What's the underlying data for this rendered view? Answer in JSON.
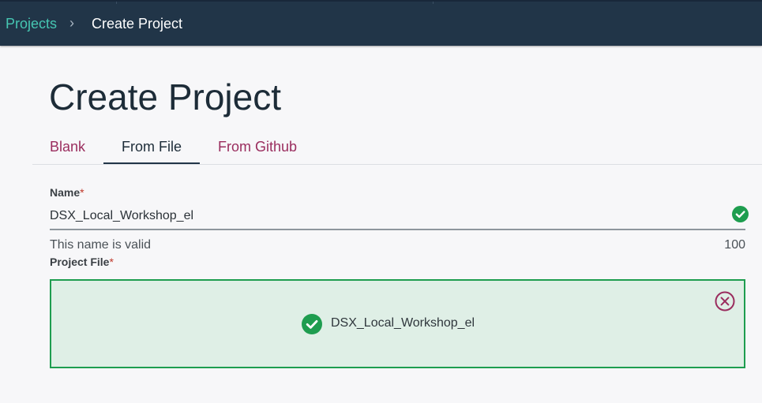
{
  "breadcrumb": {
    "parent": "Projects",
    "separator": "›",
    "current": "Create Project"
  },
  "page": {
    "title": "Create Project"
  },
  "tabs": [
    {
      "label": "Blank",
      "active": false
    },
    {
      "label": "From File",
      "active": true
    },
    {
      "label": "From Github",
      "active": false
    }
  ],
  "form": {
    "name": {
      "label": "Name",
      "required_mark": "*",
      "value": "DSX_Local_Workshop_el",
      "validation": "This name is valid",
      "max_length": "100"
    },
    "project_file": {
      "label": "Project File",
      "required_mark": "*",
      "file_name": "DSX_Local_Workshop_el"
    }
  },
  "colors": {
    "header_bg": "#213548",
    "link_teal": "#46c6b2",
    "tab_magenta": "#9a2d5e",
    "success_green": "#1e9d4f",
    "dropzone_bg": "#dfefe6"
  },
  "icons": {
    "valid": "check-circle-icon",
    "uploaded": "check-circle-icon",
    "remove": "close-circle-icon"
  }
}
